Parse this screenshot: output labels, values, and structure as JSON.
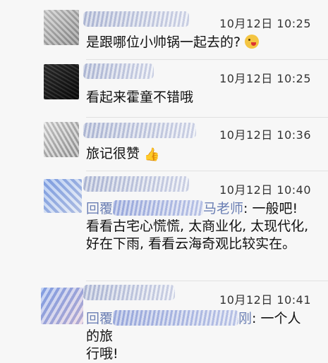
{
  "comments": [
    {
      "time": "10月12日 10:25",
      "text": "是跟哪位小帅锅一起去的?"
    },
    {
      "time": "10月12日 10:25",
      "text": "看起来霍童不错哦"
    },
    {
      "time": "10月12日 10:36",
      "text": "旅记很赞"
    },
    {
      "time": "10月12日 10:40",
      "reply_prefix": "回覆",
      "reply_suffix": "马老师",
      "text": ": 一般吧! 看看古宅心慌慌, 太商业化, 太现代化, 好在下雨, 看看云海奇观比较实在。",
      "lines": [
        "古宅心慌慌, 太商业化, 太现代代",
        "化, 好在下雨, 看看云海奇观比",
        "较实在。"
      ]
    },
    {
      "time": "10月12日 10:41",
      "reply_prefix": "回覆",
      "reply_suffix": "刚",
      "text": ": 一个人的旅",
      "line2": "行哦!"
    }
  ],
  "icons": [
    "winking-tongue-emoji",
    "thumbs-up-emoji"
  ]
}
